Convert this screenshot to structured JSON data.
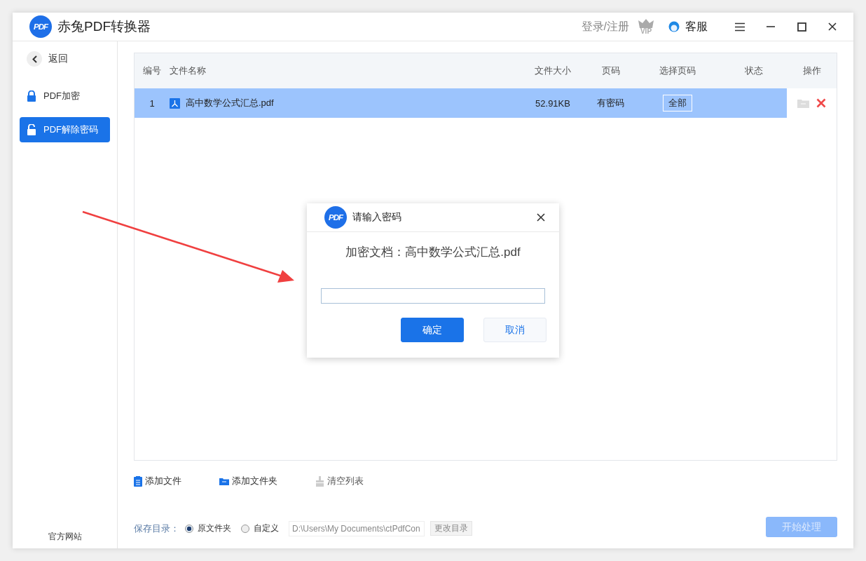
{
  "window": {
    "logo_text": "PDF",
    "title": "赤兔PDF转换器",
    "login": "登录/注册",
    "vip_badge": "VIP",
    "service": "客服"
  },
  "sidebar": {
    "back": "返回",
    "items": [
      {
        "label": "PDF加密",
        "selected": false
      },
      {
        "label": "PDF解除密码",
        "selected": true
      }
    ],
    "footer": "官方网站"
  },
  "table": {
    "columns": [
      "编号",
      "文件名称",
      "文件大小",
      "页码",
      "选择页码",
      "状态",
      "操作"
    ],
    "rows": [
      {
        "index": "1",
        "name": "高中数学公式汇总.pdf",
        "size": "52.91KB",
        "pages": "有密码",
        "page_select": "全部",
        "selected": true
      }
    ]
  },
  "toolbar": [
    {
      "kind": "file",
      "label": "添加文件",
      "disabled": false
    },
    {
      "kind": "folder",
      "label": "添加文件夹",
      "disabled": false
    },
    {
      "kind": "clear",
      "label": "清空列表",
      "disabled": true
    }
  ],
  "save": {
    "label": "保存目录：",
    "options": [
      {
        "label": "原文件夹",
        "selected": true
      },
      {
        "label": "自定义",
        "selected": false
      }
    ],
    "path": "D:\\Users\\My Documents\\ctPdfCon",
    "change": "更改目录"
  },
  "start": {
    "label": "开始处理",
    "disabled": true
  },
  "dialog": {
    "logo_text": "PDF",
    "title": "请输入密码",
    "message": "加密文档：高中数学公式汇总.pdf",
    "confirm": "确定",
    "cancel": "取消"
  }
}
